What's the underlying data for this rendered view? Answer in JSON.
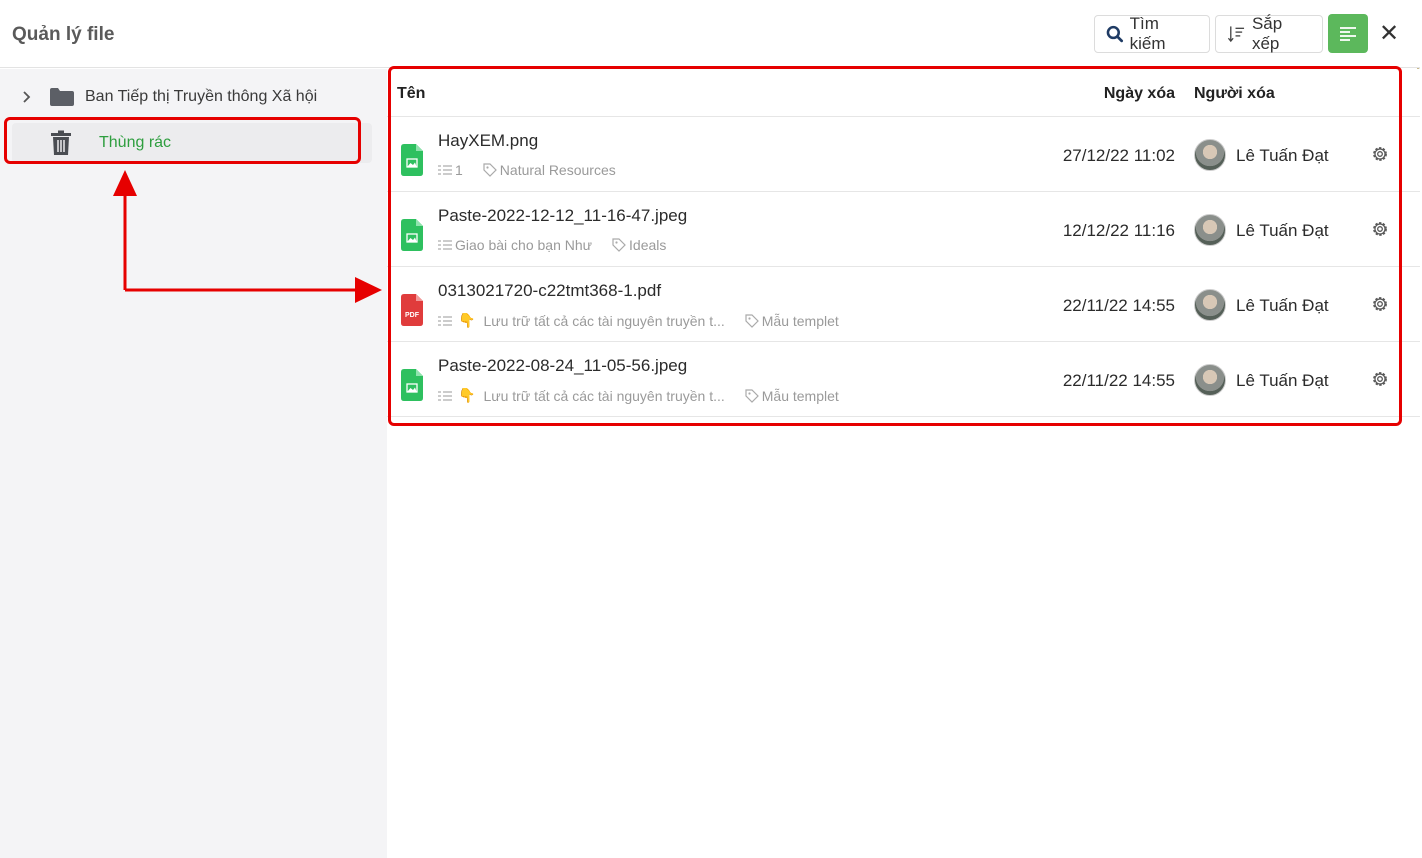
{
  "header": {
    "title": "Quản lý file",
    "search_label": "Tìm kiếm",
    "sort_label": "Sắp xếp",
    "close_label": "✕"
  },
  "sidebar": {
    "items": [
      {
        "label": "Ban Tiếp thị Truyền thông Xã hội",
        "icon": "folder-icon"
      },
      {
        "label": "Thùng rác",
        "icon": "trash-icon",
        "selected": true
      }
    ]
  },
  "table": {
    "columns": {
      "name": "Tên",
      "date": "Ngày xóa",
      "user": "Người xóa"
    },
    "rows": [
      {
        "name": "HayXEM.png",
        "type": "image",
        "meta": "1",
        "emoji": "",
        "tag": "Natural Resources",
        "date": "27/12/22 11:02",
        "user": "Lê Tuấn Đạt"
      },
      {
        "name": "Paste-2022-12-12_11-16-47.jpeg",
        "type": "image",
        "meta": "Giao bài cho bạn Như",
        "emoji": "",
        "tag": "Ideals",
        "date": "12/12/22 11:16",
        "user": "Lê Tuấn Đạt"
      },
      {
        "name": "0313021720-c22tmt368-1.pdf",
        "type": "pdf",
        "meta": "Lưu trữ tất cả các tài nguyên truyền t...",
        "emoji": "👇",
        "tag": "Mẫu templet",
        "date": "22/11/22 14:55",
        "user": "Lê Tuấn Đạt"
      },
      {
        "name": "Paste-2022-08-24_11-05-56.jpeg",
        "type": "image",
        "meta": "Lưu trữ tất cả các tài nguyên truyền t...",
        "emoji": "👇",
        "tag": "Mẫu templet",
        "date": "22/11/22 14:55",
        "user": "Lê Tuấn Đạt"
      }
    ]
  },
  "colors": {
    "accent_green": "#5cb85c",
    "selected_text": "#2e9e3f",
    "image_icon": "#2ec05f",
    "pdf_icon": "#e03c3c",
    "annotation_red": "#e60000"
  }
}
